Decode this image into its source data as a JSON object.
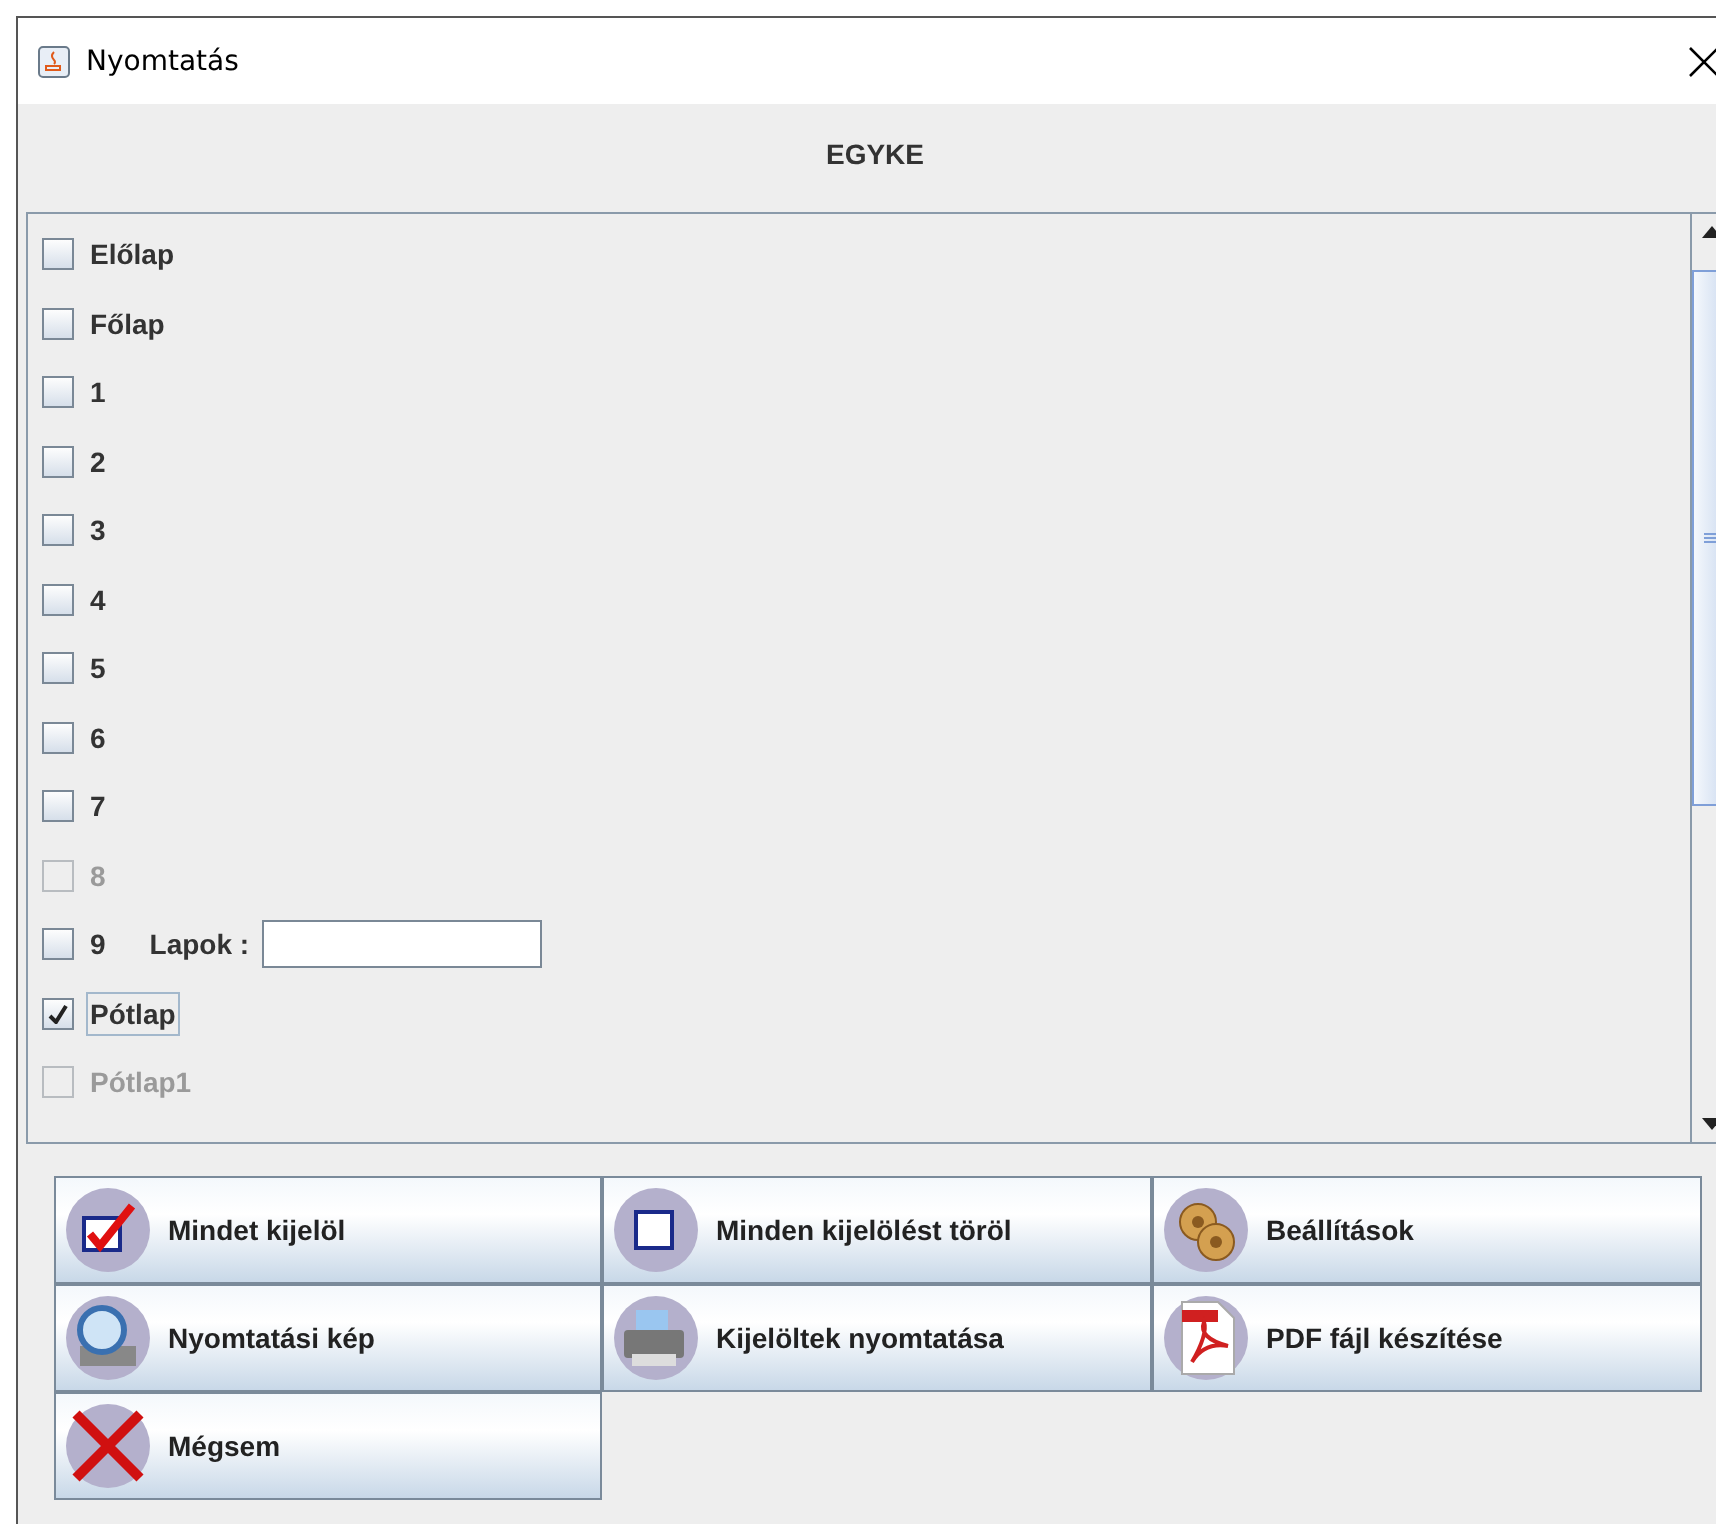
{
  "window": {
    "title": "Nyomtatás"
  },
  "header": "EGYKE",
  "items": [
    {
      "label": "Előlap",
      "checked": false,
      "disabled": false,
      "focused": false
    },
    {
      "label": "Főlap",
      "checked": false,
      "disabled": false,
      "focused": false
    },
    {
      "label": "1",
      "checked": false,
      "disabled": false,
      "focused": false
    },
    {
      "label": "2",
      "checked": false,
      "disabled": false,
      "focused": false
    },
    {
      "label": "3",
      "checked": false,
      "disabled": false,
      "focused": false
    },
    {
      "label": "4",
      "checked": false,
      "disabled": false,
      "focused": false
    },
    {
      "label": "5",
      "checked": false,
      "disabled": false,
      "focused": false
    },
    {
      "label": "6",
      "checked": false,
      "disabled": false,
      "focused": false
    },
    {
      "label": "7",
      "checked": false,
      "disabled": false,
      "focused": false
    },
    {
      "label": "8",
      "checked": false,
      "disabled": true,
      "focused": false
    },
    {
      "label": "9",
      "checked": false,
      "disabled": false,
      "focused": false,
      "field": {
        "label": "Lapok :"
      }
    },
    {
      "label": "Pótlap",
      "checked": true,
      "disabled": false,
      "focused": true
    },
    {
      "label": "Pótlap1",
      "checked": false,
      "disabled": true,
      "focused": false
    }
  ],
  "buttons": [
    {
      "label": "Mindet kijelöl",
      "kind": "check"
    },
    {
      "label": "Minden kijelölést töröl",
      "kind": "uncheck"
    },
    {
      "label": "Beállítások",
      "kind": "settings"
    },
    {
      "label": "Nyomtatási kép",
      "kind": "preview"
    },
    {
      "label": "Kijelöltek nyomtatása",
      "kind": "printer"
    },
    {
      "label": "PDF fájl készítése",
      "kind": "pdf"
    },
    {
      "label": "Mégsem",
      "kind": "cancel"
    }
  ]
}
